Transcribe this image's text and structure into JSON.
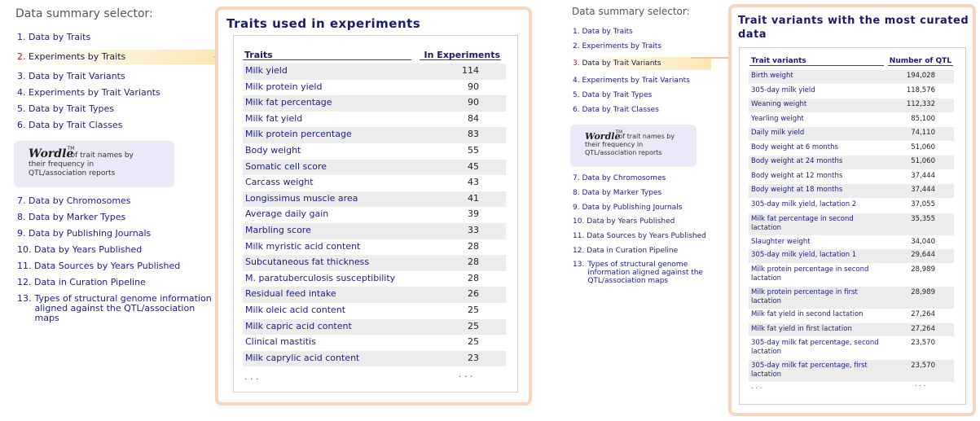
{
  "left": {
    "selector_title": "Data summary selector:",
    "menu_top": [
      {
        "num": "1.",
        "label": "Data by Traits"
      },
      {
        "num": "2.",
        "label": "Experiments by Traits",
        "active": true
      },
      {
        "num": "3.",
        "label": "Data by Trait Variants"
      },
      {
        "num": "4.",
        "label": "Experiments by Trait Variants"
      },
      {
        "num": "5.",
        "label": "Data by Trait Types"
      },
      {
        "num": "6.",
        "label": "Data by Trait Classes"
      }
    ],
    "wordle": {
      "logo": "Wordle",
      "tm": "TM",
      "text1": "of trait names by",
      "text2": "their frequency in",
      "text3": "QTL/association reports"
    },
    "menu_bottom": [
      {
        "num": "7.",
        "label": "Data by Chromosomes"
      },
      {
        "num": "8.",
        "label": "Data by Marker Types"
      },
      {
        "num": "9.",
        "label": "Data by Publishing Journals"
      },
      {
        "num": "10.",
        "label": "Data by Years Published"
      },
      {
        "num": "11.",
        "label": "Data Sources by Years Published"
      },
      {
        "num": "12.",
        "label": "Data in Curation Pipeline"
      },
      {
        "num": "13.",
        "label": "Types of structural genome information aligned against the QTL/association maps"
      }
    ],
    "panel": {
      "title": "Traits used in experiments",
      "col1": "Traits",
      "col2": "In Experiments",
      "rows": [
        [
          "Milk yield",
          "114"
        ],
        [
          "Milk protein yield",
          "90"
        ],
        [
          "Milk fat percentage",
          "90"
        ],
        [
          "Milk fat yield",
          "84"
        ],
        [
          "Milk protein percentage",
          "83"
        ],
        [
          "Body weight",
          "55"
        ],
        [
          "Somatic cell score",
          "45"
        ],
        [
          "Carcass weight",
          "43"
        ],
        [
          "Longissimus muscle area",
          "41"
        ],
        [
          "Average daily gain",
          "39"
        ],
        [
          "Marbling score",
          "33"
        ],
        [
          "Milk myristic acid content",
          "28"
        ],
        [
          "Subcutaneous fat thickness",
          "28"
        ],
        [
          "M. paratuberculosis susceptibility",
          "28"
        ],
        [
          "Residual feed intake",
          "26"
        ],
        [
          "Milk oleic acid content",
          "25"
        ],
        [
          "Milk capric acid content",
          "25"
        ],
        [
          "Clinical mastitis",
          "25"
        ],
        [
          "Milk caprylic acid content",
          "23"
        ]
      ],
      "ellipsis_left": ". . .",
      "ellipsis_right": ". . ."
    }
  },
  "right": {
    "selector_title": "Data summary selector:",
    "menu_top": [
      {
        "num": "1.",
        "label": "Data by Traits"
      },
      {
        "num": "2.",
        "label": "Experiments by Traits"
      },
      {
        "num": "3.",
        "label": "Data by Trait Variants",
        "active": true
      },
      {
        "num": "4.",
        "label": "Experiments by Trait Variants"
      },
      {
        "num": "5.",
        "label": "Data by Trait Types"
      },
      {
        "num": "6.",
        "label": "Data by Trait Classes"
      }
    ],
    "wordle": {
      "logo": "Wordle",
      "tm": "TM",
      "text1": "of trait names by",
      "text2": "their frequency in",
      "text3": "QTL/association reports"
    },
    "menu_bottom": [
      {
        "num": "7.",
        "label": "Data by Chromosomes"
      },
      {
        "num": "8.",
        "label": "Data by Marker Types"
      },
      {
        "num": "9.",
        "label": "Data by Publishing Journals"
      },
      {
        "num": "10.",
        "label": "Data by Years Published"
      },
      {
        "num": "11.",
        "label": "Data Sources by Years Published"
      },
      {
        "num": "12.",
        "label": "Data in Curation Pipeline"
      },
      {
        "num": "13.",
        "label": "Types of structural genome information aligned against the QTL/association maps"
      }
    ],
    "panel": {
      "title": "Trait variants with the most curated data",
      "col1": "Trait variants",
      "col2": "Number of QTL",
      "rows": [
        [
          "Birth weight",
          "194,028"
        ],
        [
          "305-day milk yield",
          "118,576"
        ],
        [
          "Weaning weight",
          "112,332"
        ],
        [
          "Yearling weight",
          "85,100"
        ],
        [
          "Daily milk yield",
          "74,110"
        ],
        [
          "Body weight at 6 months",
          "51,060"
        ],
        [
          "Body weight at 24 months",
          "51,060"
        ],
        [
          "Body weight at 12 months",
          "37,444"
        ],
        [
          "Body weight at 18 months",
          "37,444"
        ],
        [
          "305-day milk yield, lactation 2",
          "37,055"
        ],
        [
          "Milk fat percentage in second lactation",
          "35,355"
        ],
        [
          "Slaughter weight",
          "34,040"
        ],
        [
          "305-day milk yield, lactation 1",
          "29,644"
        ],
        [
          "Milk protein percentage in second lactation",
          "28,989"
        ],
        [
          "Milk protein percentage in first lactation",
          "28,989"
        ],
        [
          "Milk fat yield in second lactation",
          "27,264"
        ],
        [
          "Milk fat yield in first lactation",
          "27,264"
        ],
        [
          "305-day milk fat percentage, second lactation",
          "23,570"
        ],
        [
          "305-day milk fat percentage, first lactation",
          "23,570"
        ]
      ],
      "ellipsis_left": ". . .",
      "ellipsis_right": ". . ."
    }
  }
}
